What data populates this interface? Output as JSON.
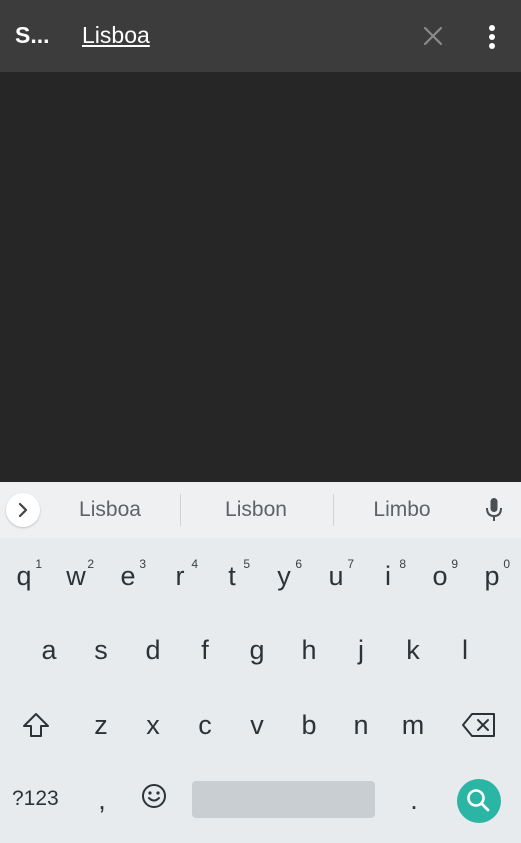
{
  "app_bar": {
    "title": "S...",
    "search_value": "Lisboa",
    "clear_icon": "close-icon",
    "more_icon": "more-vert-icon"
  },
  "keyboard": {
    "suggestions": [
      "Lisboa",
      "Lisbon",
      "Limbo"
    ],
    "row1": [
      {
        "key": "q",
        "hint": "1"
      },
      {
        "key": "w",
        "hint": "2"
      },
      {
        "key": "e",
        "hint": "3"
      },
      {
        "key": "r",
        "hint": "4"
      },
      {
        "key": "t",
        "hint": "5"
      },
      {
        "key": "y",
        "hint": "6"
      },
      {
        "key": "u",
        "hint": "7"
      },
      {
        "key": "i",
        "hint": "8"
      },
      {
        "key": "o",
        "hint": "9"
      },
      {
        "key": "p",
        "hint": "0"
      }
    ],
    "row2": [
      "a",
      "s",
      "d",
      "f",
      "g",
      "h",
      "j",
      "k",
      "l"
    ],
    "row3": [
      "z",
      "x",
      "c",
      "v",
      "b",
      "n",
      "m"
    ],
    "symbols_label": "?123",
    "comma": ",",
    "period": ".",
    "colors": {
      "search_key": "#2bb5a4",
      "app_bar": "#3c3c3c",
      "content_bg": "#262626"
    }
  }
}
